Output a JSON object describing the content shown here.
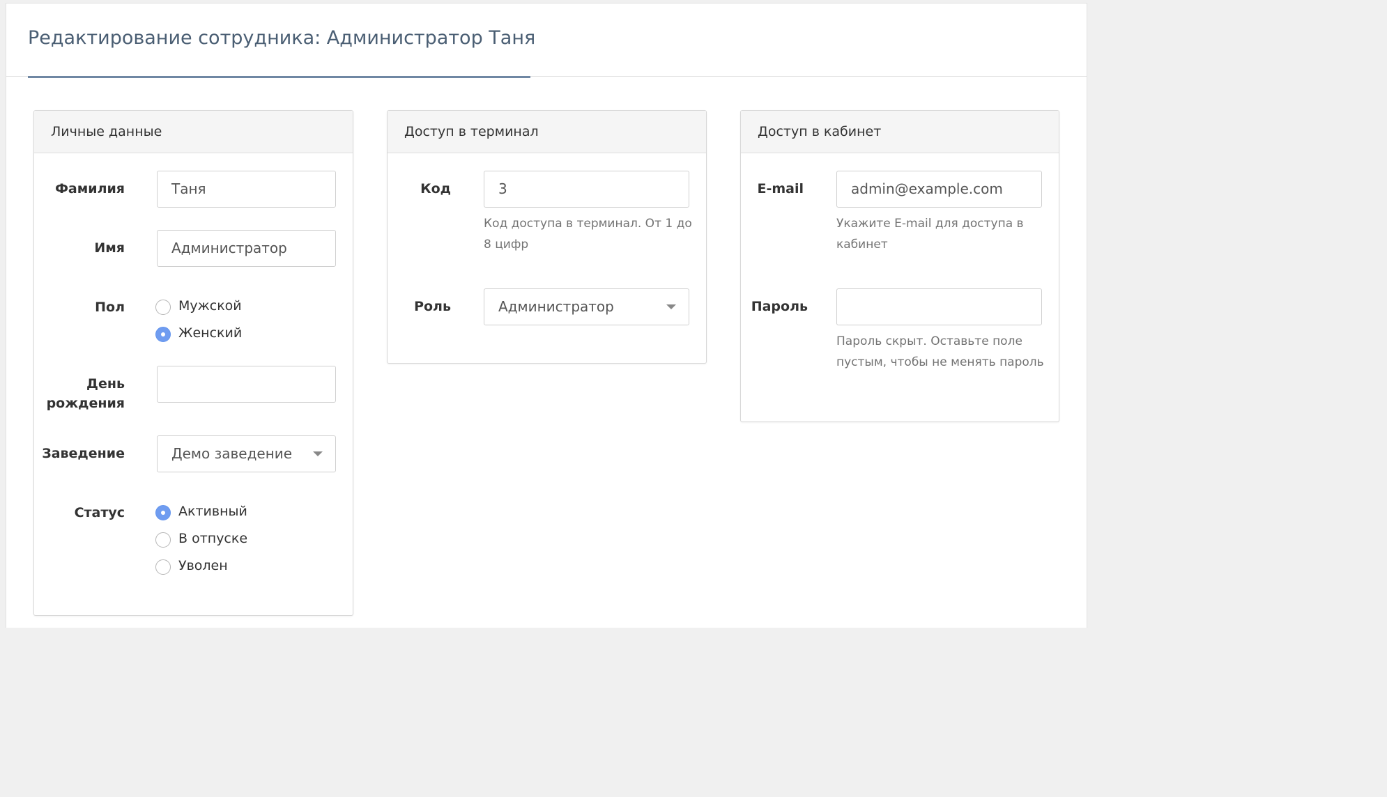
{
  "header": {
    "title": "Редактирование сотрудника: Администратор Таня"
  },
  "personal": {
    "heading": "Личные данные",
    "lastname": {
      "label": "Фамилия",
      "value": "Таня"
    },
    "firstname": {
      "label": "Имя",
      "value": "Администратор"
    },
    "gender": {
      "label": "Пол",
      "options": [
        {
          "label": "Мужской",
          "checked": false
        },
        {
          "label": "Женский",
          "checked": true
        }
      ]
    },
    "birthday": {
      "label_line1": "День",
      "label_line2": "рождения",
      "value": ""
    },
    "venue": {
      "label": "Заведение",
      "value": "Демо заведение"
    },
    "status": {
      "label": "Статус",
      "options": [
        {
          "label": "Активный",
          "checked": true
        },
        {
          "label": "В отпуске",
          "checked": false
        },
        {
          "label": "Уволен",
          "checked": false
        }
      ]
    }
  },
  "terminal": {
    "heading": "Доступ в терминал",
    "code": {
      "label": "Код",
      "value": "3",
      "help_line1": "Код доступа в терминал. От 1 до",
      "help_line2": "8 цифр"
    },
    "role": {
      "label": "Роль",
      "value": "Администратор"
    }
  },
  "cabinet": {
    "heading": "Доступ в кабинет",
    "email": {
      "label": "E-mail",
      "value": "admin@example.com",
      "help_line1": "Укажите E-mail для доступа в",
      "help_line2": "кабинет"
    },
    "password": {
      "label": "Пароль",
      "value": "",
      "help_line1": "Пароль скрыт. Оставьте поле",
      "help_line2": "пустым, чтобы не менять пароль"
    }
  }
}
